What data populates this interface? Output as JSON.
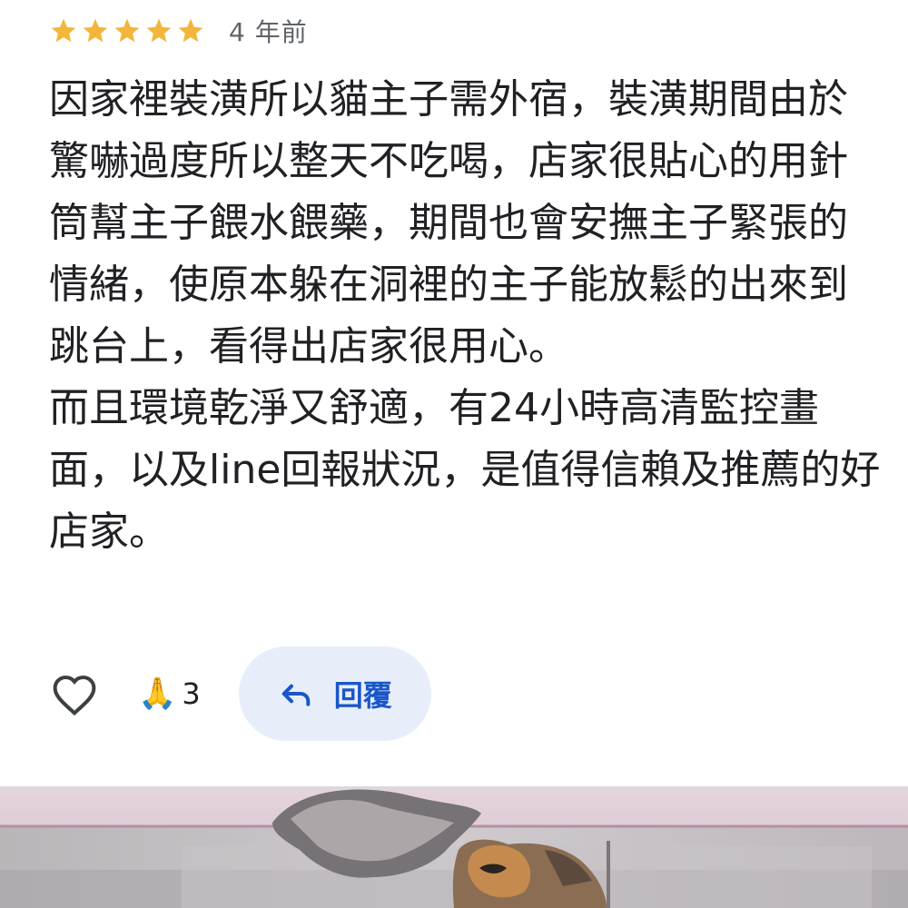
{
  "review": {
    "rating": 5,
    "rating_max": 5,
    "star_color": "#f2b63a",
    "date": "4 年前",
    "paragraphs": [
      "因家裡裝潢所以貓主子需外宿，裝潢期間由於驚嚇過度所以整天不吃喝，店家很貼心的用針筒幫主子餵水餵藥，期間也會安撫主子緊張的情緒，使原本躲在洞裡的主子能放鬆的出來到跳台上，看得出店家很用心。",
      "而且環境乾淨又舒適，有24小時高清監控畫面，以及line回報狀況，是值得信賴及推薦的好店家。"
    ]
  },
  "actions": {
    "like_icon": "heart-outline-icon",
    "reaction_icon": "folded-hands-emoji",
    "reaction_emoji": "🙏",
    "reaction_count": "3",
    "reply_icon": "reply-arrow-icon",
    "reply_label": "回覆",
    "reply_color": "#1a56c9",
    "reply_bg": "#e8eef9"
  },
  "photo": {
    "subject": "cat-photo"
  }
}
